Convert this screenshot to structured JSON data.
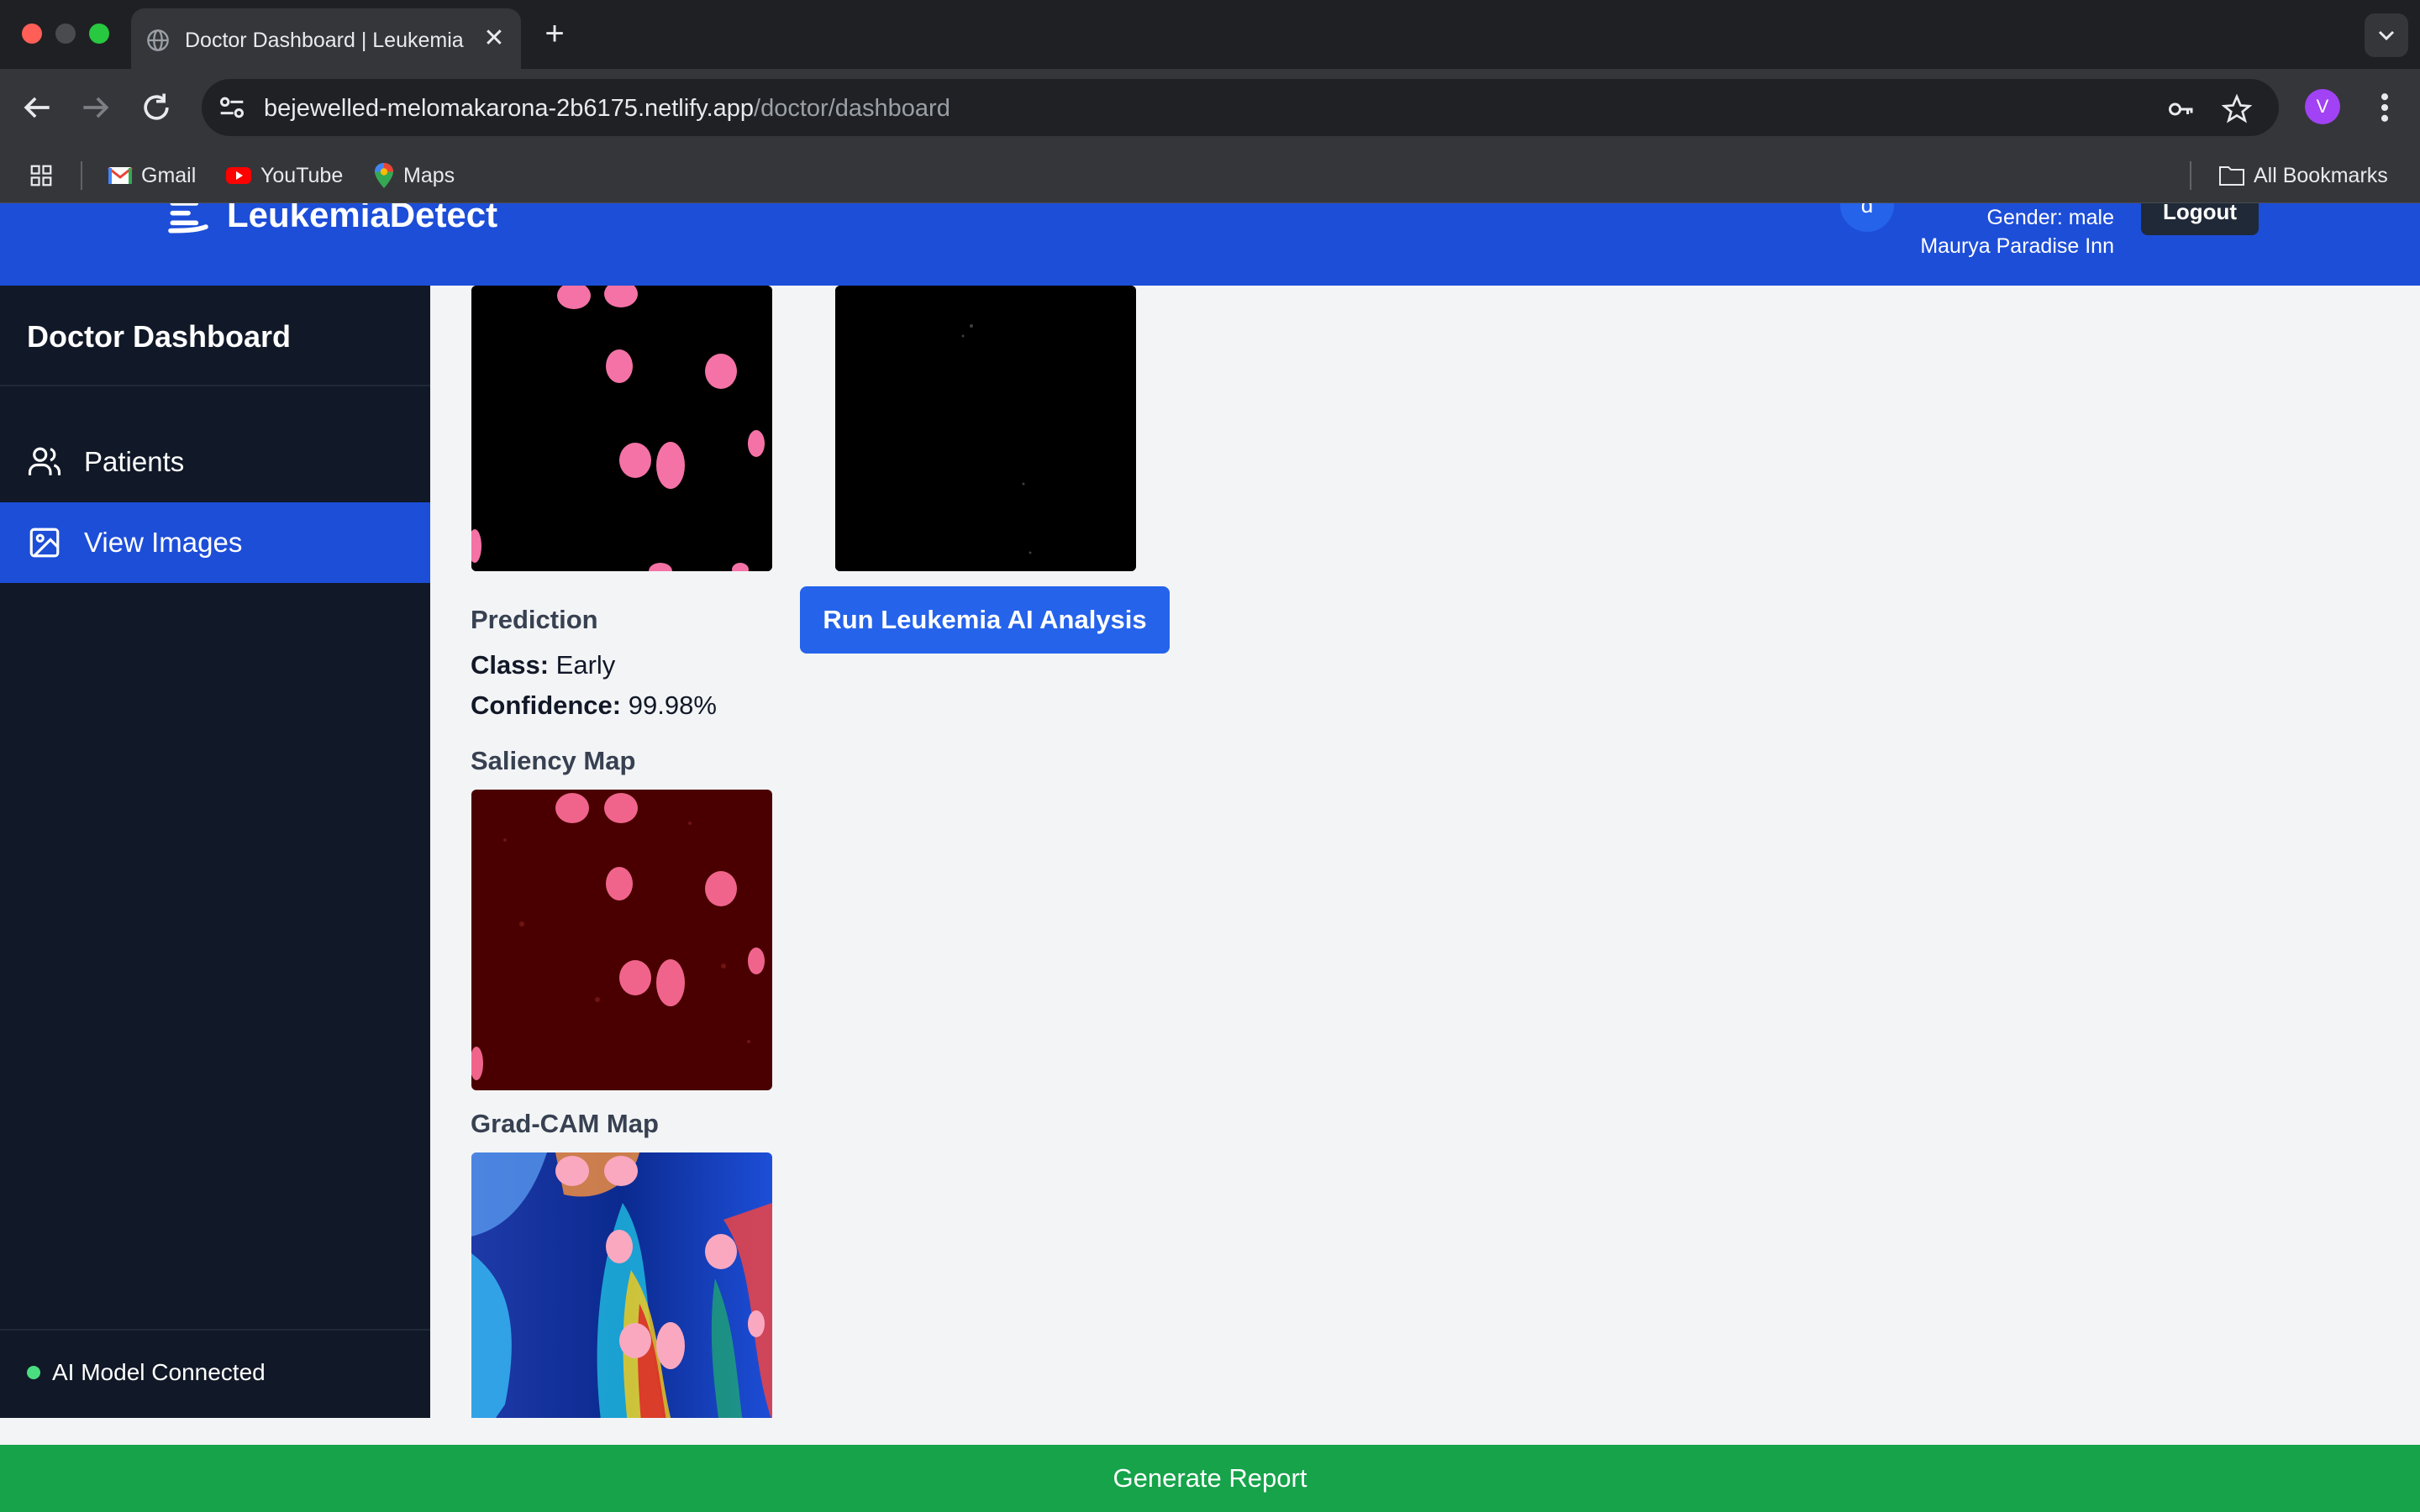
{
  "browser": {
    "tab_title": "Doctor Dashboard | Leukemia",
    "tab_close": "✕",
    "new_tab": "+",
    "url_host": "bejewelled-melomakarona-2b6175.netlify.app",
    "url_path": "/doctor/dashboard",
    "profile_initial": "V",
    "bookmarks": [
      {
        "label": "Gmail"
      },
      {
        "label": "YouTube"
      },
      {
        "label": "Maps"
      }
    ],
    "all_bookmarks": "All Bookmarks"
  },
  "header": {
    "logo_text": "LeukemiaDetect",
    "profile_initial": "d",
    "gender": "Gender: male",
    "address": "Maurya Paradise Inn",
    "logout": "Logout"
  },
  "sidebar": {
    "title": "Doctor Dashboard",
    "items": [
      {
        "label": "Patients",
        "icon": "users-icon",
        "active": false
      },
      {
        "label": "View Images",
        "icon": "image-icon",
        "active": true
      }
    ],
    "status": "AI Model Connected"
  },
  "main": {
    "run_button": "Run Leukemia AI Analysis",
    "prediction": {
      "heading": "Prediction",
      "class_label": "Class:",
      "class_value": "Early",
      "confidence_label": "Confidence:",
      "confidence_value": "99.98%"
    },
    "saliency_heading": "Saliency Map",
    "gradcam_heading": "Grad-CAM Map"
  },
  "footer": {
    "generate_report": "Generate Report"
  },
  "colors": {
    "header_blue": "#1d4ed8",
    "sidebar_bg": "#111827",
    "button_blue": "#2563eb",
    "report_green": "#16a34a",
    "status_green": "#4ade80"
  }
}
